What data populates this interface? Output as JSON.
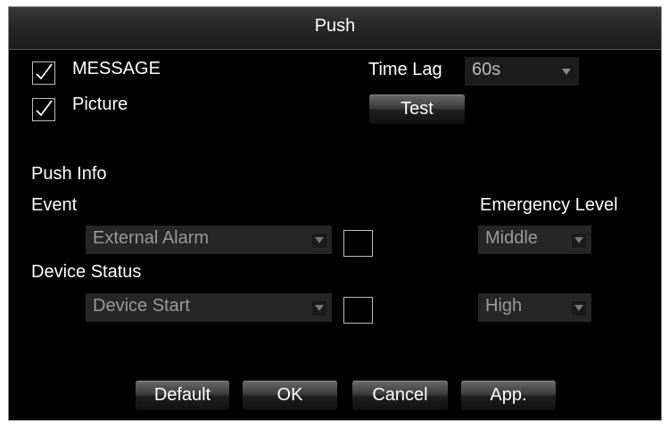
{
  "dialog": {
    "title": "Push",
    "message_checkbox": {
      "label": "MESSAGE",
      "checked": true
    },
    "picture_checkbox": {
      "label": "Picture",
      "checked": true
    },
    "time_lag": {
      "label": "Time Lag",
      "value": "60s"
    },
    "test_button": "Test",
    "push_info_label": "Push Info",
    "event_label": "Event",
    "emergency_level_label": "Emergency Level",
    "event_select": {
      "value": "External Alarm",
      "enabled": false
    },
    "event_checkbox": {
      "checked": false
    },
    "event_level_select": {
      "value": "Middle",
      "enabled": false
    },
    "device_status_label": "Device Status",
    "device_status_select": {
      "value": "Device Start",
      "enabled": false
    },
    "device_status_checkbox": {
      "checked": false
    },
    "device_status_level_select": {
      "value": "High",
      "enabled": false
    },
    "buttons": {
      "default": "Default",
      "ok": "OK",
      "cancel": "Cancel",
      "apply": "App."
    }
  }
}
